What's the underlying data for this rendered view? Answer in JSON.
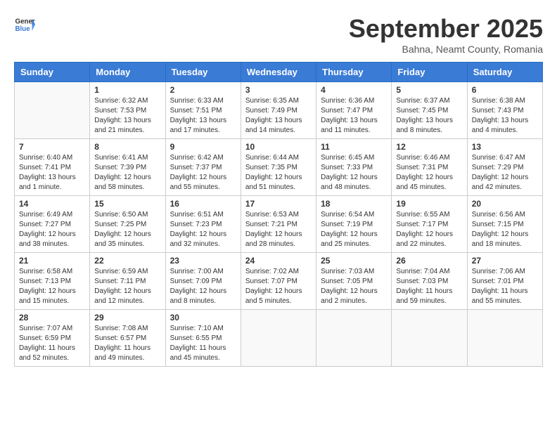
{
  "header": {
    "logo_line1": "General",
    "logo_line2": "Blue",
    "month": "September 2025",
    "location": "Bahna, Neamt County, Romania"
  },
  "weekdays": [
    "Sunday",
    "Monday",
    "Tuesday",
    "Wednesday",
    "Thursday",
    "Friday",
    "Saturday"
  ],
  "weeks": [
    [
      {
        "day": "",
        "info": ""
      },
      {
        "day": "1",
        "info": "Sunrise: 6:32 AM\nSunset: 7:53 PM\nDaylight: 13 hours\nand 21 minutes."
      },
      {
        "day": "2",
        "info": "Sunrise: 6:33 AM\nSunset: 7:51 PM\nDaylight: 13 hours\nand 17 minutes."
      },
      {
        "day": "3",
        "info": "Sunrise: 6:35 AM\nSunset: 7:49 PM\nDaylight: 13 hours\nand 14 minutes."
      },
      {
        "day": "4",
        "info": "Sunrise: 6:36 AM\nSunset: 7:47 PM\nDaylight: 13 hours\nand 11 minutes."
      },
      {
        "day": "5",
        "info": "Sunrise: 6:37 AM\nSunset: 7:45 PM\nDaylight: 13 hours\nand 8 minutes."
      },
      {
        "day": "6",
        "info": "Sunrise: 6:38 AM\nSunset: 7:43 PM\nDaylight: 13 hours\nand 4 minutes."
      }
    ],
    [
      {
        "day": "7",
        "info": "Sunrise: 6:40 AM\nSunset: 7:41 PM\nDaylight: 13 hours\nand 1 minute."
      },
      {
        "day": "8",
        "info": "Sunrise: 6:41 AM\nSunset: 7:39 PM\nDaylight: 12 hours\nand 58 minutes."
      },
      {
        "day": "9",
        "info": "Sunrise: 6:42 AM\nSunset: 7:37 PM\nDaylight: 12 hours\nand 55 minutes."
      },
      {
        "day": "10",
        "info": "Sunrise: 6:44 AM\nSunset: 7:35 PM\nDaylight: 12 hours\nand 51 minutes."
      },
      {
        "day": "11",
        "info": "Sunrise: 6:45 AM\nSunset: 7:33 PM\nDaylight: 12 hours\nand 48 minutes."
      },
      {
        "day": "12",
        "info": "Sunrise: 6:46 AM\nSunset: 7:31 PM\nDaylight: 12 hours\nand 45 minutes."
      },
      {
        "day": "13",
        "info": "Sunrise: 6:47 AM\nSunset: 7:29 PM\nDaylight: 12 hours\nand 42 minutes."
      }
    ],
    [
      {
        "day": "14",
        "info": "Sunrise: 6:49 AM\nSunset: 7:27 PM\nDaylight: 12 hours\nand 38 minutes."
      },
      {
        "day": "15",
        "info": "Sunrise: 6:50 AM\nSunset: 7:25 PM\nDaylight: 12 hours\nand 35 minutes."
      },
      {
        "day": "16",
        "info": "Sunrise: 6:51 AM\nSunset: 7:23 PM\nDaylight: 12 hours\nand 32 minutes."
      },
      {
        "day": "17",
        "info": "Sunrise: 6:53 AM\nSunset: 7:21 PM\nDaylight: 12 hours\nand 28 minutes."
      },
      {
        "day": "18",
        "info": "Sunrise: 6:54 AM\nSunset: 7:19 PM\nDaylight: 12 hours\nand 25 minutes."
      },
      {
        "day": "19",
        "info": "Sunrise: 6:55 AM\nSunset: 7:17 PM\nDaylight: 12 hours\nand 22 minutes."
      },
      {
        "day": "20",
        "info": "Sunrise: 6:56 AM\nSunset: 7:15 PM\nDaylight: 12 hours\nand 18 minutes."
      }
    ],
    [
      {
        "day": "21",
        "info": "Sunrise: 6:58 AM\nSunset: 7:13 PM\nDaylight: 12 hours\nand 15 minutes."
      },
      {
        "day": "22",
        "info": "Sunrise: 6:59 AM\nSunset: 7:11 PM\nDaylight: 12 hours\nand 12 minutes."
      },
      {
        "day": "23",
        "info": "Sunrise: 7:00 AM\nSunset: 7:09 PM\nDaylight: 12 hours\nand 8 minutes."
      },
      {
        "day": "24",
        "info": "Sunrise: 7:02 AM\nSunset: 7:07 PM\nDaylight: 12 hours\nand 5 minutes."
      },
      {
        "day": "25",
        "info": "Sunrise: 7:03 AM\nSunset: 7:05 PM\nDaylight: 12 hours\nand 2 minutes."
      },
      {
        "day": "26",
        "info": "Sunrise: 7:04 AM\nSunset: 7:03 PM\nDaylight: 11 hours\nand 59 minutes."
      },
      {
        "day": "27",
        "info": "Sunrise: 7:06 AM\nSunset: 7:01 PM\nDaylight: 11 hours\nand 55 minutes."
      }
    ],
    [
      {
        "day": "28",
        "info": "Sunrise: 7:07 AM\nSunset: 6:59 PM\nDaylight: 11 hours\nand 52 minutes."
      },
      {
        "day": "29",
        "info": "Sunrise: 7:08 AM\nSunset: 6:57 PM\nDaylight: 11 hours\nand 49 minutes."
      },
      {
        "day": "30",
        "info": "Sunrise: 7:10 AM\nSunset: 6:55 PM\nDaylight: 11 hours\nand 45 minutes."
      },
      {
        "day": "",
        "info": ""
      },
      {
        "day": "",
        "info": ""
      },
      {
        "day": "",
        "info": ""
      },
      {
        "day": "",
        "info": ""
      }
    ]
  ]
}
